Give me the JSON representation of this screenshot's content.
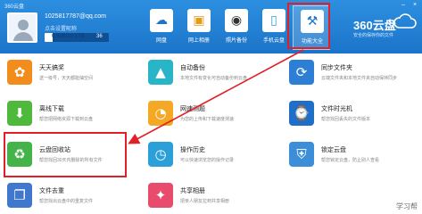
{
  "window": {
    "title": "360云盘",
    "min": "–",
    "close": "×"
  },
  "user": {
    "email": "1025817787@qq.com",
    "status": "点击设置昵称",
    "storage_used_text": "0.50B/10.1TB",
    "storage_total_text": "36",
    "storage_fraction": 0.12
  },
  "nav": [
    {
      "label": "网盘",
      "icon": "cloud-icon"
    },
    {
      "label": "网上相册",
      "icon": "image-icon"
    },
    {
      "label": "照片备份",
      "icon": "camera-icon"
    },
    {
      "label": "手机云盘",
      "icon": "phone-icon"
    },
    {
      "label": "功能大全",
      "icon": "toolbox-icon"
    }
  ],
  "brand": {
    "name": "360云盘",
    "slogan": "安全的保存你的文件"
  },
  "tiles": [
    {
      "title": "天天搞奖",
      "desc": "送一级号，天天都能抽空间",
      "icon": "gift-icon",
      "color": "#f28c1c"
    },
    {
      "title": "自动备份",
      "desc": "本地文件有变化可自动备份到云盘",
      "icon": "upload-icon",
      "color": "#29b5c8"
    },
    {
      "title": "同步文件夹",
      "desc": "云端文件夹和本地文件夹自动保持同步",
      "icon": "sync-icon",
      "color": "#2d7fd6"
    },
    {
      "title": "离线下载",
      "desc": "帮您把网络资源下载到云盘",
      "icon": "download-icon",
      "color": "#4fb93b"
    },
    {
      "title": "网速测题",
      "desc": "为您的上传和下载速度测速",
      "icon": "speedometer-icon",
      "color": "#f5a823"
    },
    {
      "title": "文件时光机",
      "desc": "帮您找回丢失的文件版本",
      "icon": "time-machine-icon",
      "color": "#1f6ec7"
    },
    {
      "title": "云盘回收站",
      "desc": "帮您找回30天内删除的所有文件",
      "icon": "recycle-icon",
      "color": "#43b34a"
    },
    {
      "title": "操作历史",
      "desc": "可以快速浏览您的操作记录",
      "icon": "clock-icon",
      "color": "#2a9fd8"
    },
    {
      "title": "锁定云盘",
      "desc": "帮您锁定云盘，防止别人查看",
      "icon": "shield-icon",
      "color": "#3c8ed8"
    },
    {
      "title": "文件去重",
      "desc": "帮您找出云盘中的重复文件",
      "icon": "files-icon",
      "color": "#3f78cc"
    },
    {
      "title": "共享相册",
      "desc": "把亲人朋友拉到共享相册",
      "icon": "photo-share-icon",
      "color": "#e84b6c"
    },
    {
      "title": "",
      "desc": "",
      "icon": "",
      "color": "#ffffff"
    }
  ],
  "watermark": "学习帮"
}
